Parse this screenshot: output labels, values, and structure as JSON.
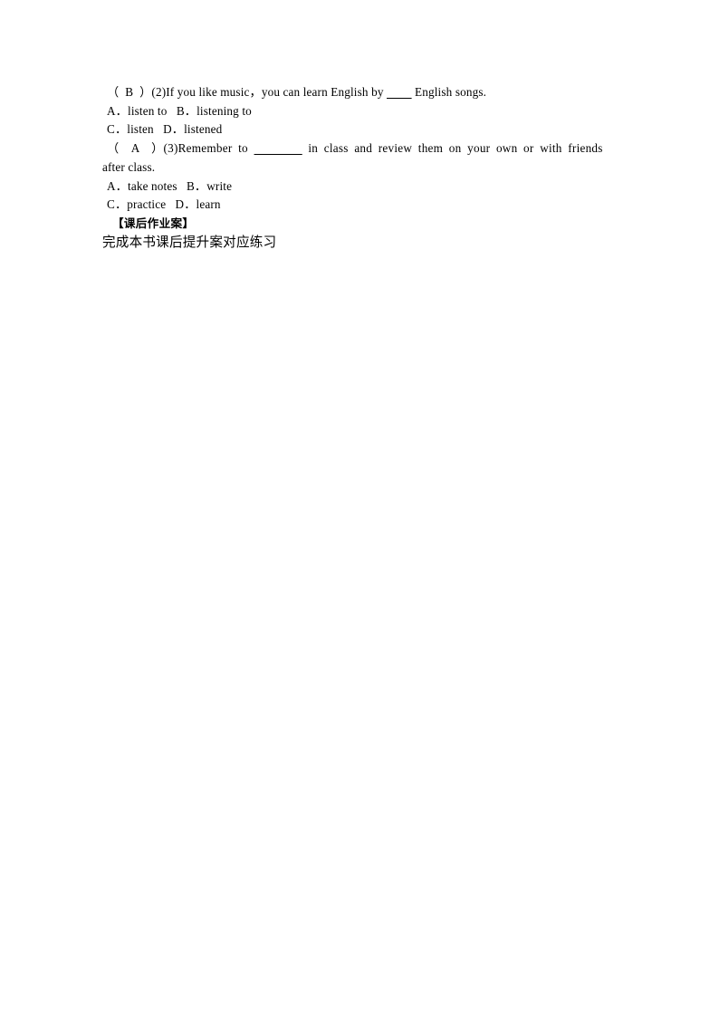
{
  "document": {
    "page_background": "#ffffff",
    "text_color": "#000000",
    "lines": [
      {
        "id": "q2-stem",
        "answer_bracket": "（ B ）",
        "number": "(2)",
        "text": "（  B  ）(2)If you like music，you can learn English by ________ English songs."
      },
      {
        "id": "q2-options-ab",
        "text": "A．listen to   B．listening to"
      },
      {
        "id": "q2-options-cd",
        "text": "C．listen   D．listened"
      },
      {
        "id": "q3-stem-line1",
        "answer_bracket": "（ A ）",
        "number": "(3)",
        "text": "（  A  ）(3)Remember to ________ in class and review them on your own or with friends"
      },
      {
        "id": "q3-stem-line2",
        "text": "after class."
      },
      {
        "id": "q3-options-ab",
        "text": "A．take notes   B．write"
      },
      {
        "id": "q3-options-cd",
        "text": "C．practice   D．learn"
      },
      {
        "id": "homework-heading",
        "text": "【课后作业案】"
      },
      {
        "id": "homework-body",
        "text": "完成本书课后提升案对应练习"
      }
    ]
  },
  "questions": [
    {
      "number": "(2)",
      "answer": "B",
      "stem_before_blank": "（  B  ）(2)If you like music，you can learn English by ",
      "blank": "________",
      "stem_after_blank": " English songs.",
      "options": [
        {
          "letter": "A．",
          "label": "listen to"
        },
        {
          "letter": "B．",
          "label": "listening to"
        },
        {
          "letter": "C．",
          "label": "listen"
        },
        {
          "letter": "D．",
          "label": "listened"
        }
      ]
    },
    {
      "number": "(3)",
      "answer": "A",
      "stem_before_blank": "（  A  ）(3)Remember to ",
      "blank": "________",
      "stem_after_blank": " in class and review them on your own or with friends",
      "stem_continuation": "after class.",
      "options": [
        {
          "letter": "A．",
          "label": "take notes"
        },
        {
          "letter": "B．",
          "label": "write"
        },
        {
          "letter": "C．",
          "label": "practice"
        },
        {
          "letter": "D．",
          "label": "learn"
        }
      ]
    }
  ],
  "homework_section": {
    "heading": "【课后作业案】",
    "body": "完成本书课后提升案对应练习"
  }
}
